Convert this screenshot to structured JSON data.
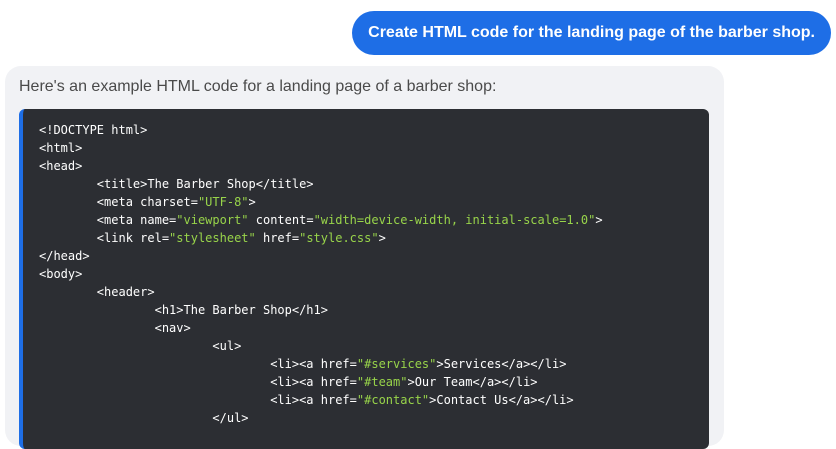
{
  "user_message": "Create HTML code for the landing page of the barber shop.",
  "assistant": {
    "intro": "Here's an example HTML code for a landing page of a barber shop:",
    "code_lines": [
      [
        {
          "t": "<!DOCTYPE html>",
          "k": "plain"
        }
      ],
      [
        {
          "t": "<html>",
          "k": "plain"
        }
      ],
      [
        {
          "t": "<head>",
          "k": "plain"
        }
      ],
      [
        {
          "t": "        <title>The Barber Shop</title>",
          "k": "plain"
        }
      ],
      [
        {
          "t": "        <meta charset=",
          "k": "plain"
        },
        {
          "t": "\"UTF-8\"",
          "k": "str"
        },
        {
          "t": ">",
          "k": "plain"
        }
      ],
      [
        {
          "t": "        <meta name=",
          "k": "plain"
        },
        {
          "t": "\"viewport\"",
          "k": "str"
        },
        {
          "t": " content=",
          "k": "plain"
        },
        {
          "t": "\"width=device-width, initial-scale=1.0\"",
          "k": "str"
        },
        {
          "t": ">",
          "k": "plain"
        }
      ],
      [
        {
          "t": "        <link rel=",
          "k": "plain"
        },
        {
          "t": "\"stylesheet\"",
          "k": "str"
        },
        {
          "t": " href=",
          "k": "plain"
        },
        {
          "t": "\"style.css\"",
          "k": "str"
        },
        {
          "t": ">",
          "k": "plain"
        }
      ],
      [
        {
          "t": "</head>",
          "k": "plain"
        }
      ],
      [
        {
          "t": "<body>",
          "k": "plain"
        }
      ],
      [
        {
          "t": "        <header>",
          "k": "plain"
        }
      ],
      [
        {
          "t": "                <h1>The Barber Shop</h1>",
          "k": "plain"
        }
      ],
      [
        {
          "t": "                <nav>",
          "k": "plain"
        }
      ],
      [
        {
          "t": "                        <ul>",
          "k": "plain"
        }
      ],
      [
        {
          "t": "                                <li><a href=",
          "k": "plain"
        },
        {
          "t": "\"#services\"",
          "k": "str"
        },
        {
          "t": ">Services</a></li>",
          "k": "plain"
        }
      ],
      [
        {
          "t": "                                <li><a href=",
          "k": "plain"
        },
        {
          "t": "\"#team\"",
          "k": "str"
        },
        {
          "t": ">Our Team</a></li>",
          "k": "plain"
        }
      ],
      [
        {
          "t": "                                <li><a href=",
          "k": "plain"
        },
        {
          "t": "\"#contact\"",
          "k": "str"
        },
        {
          "t": ">Contact Us</a></li>",
          "k": "plain"
        }
      ],
      [
        {
          "t": "                        </ul>",
          "k": "plain"
        }
      ]
    ]
  },
  "colors": {
    "user_bubble": "#1e6ee6",
    "assistant_bubble": "#f1f2f5",
    "code_background": "#2c2e33",
    "code_string": "#98d44a",
    "code_text": "#ffffff"
  }
}
